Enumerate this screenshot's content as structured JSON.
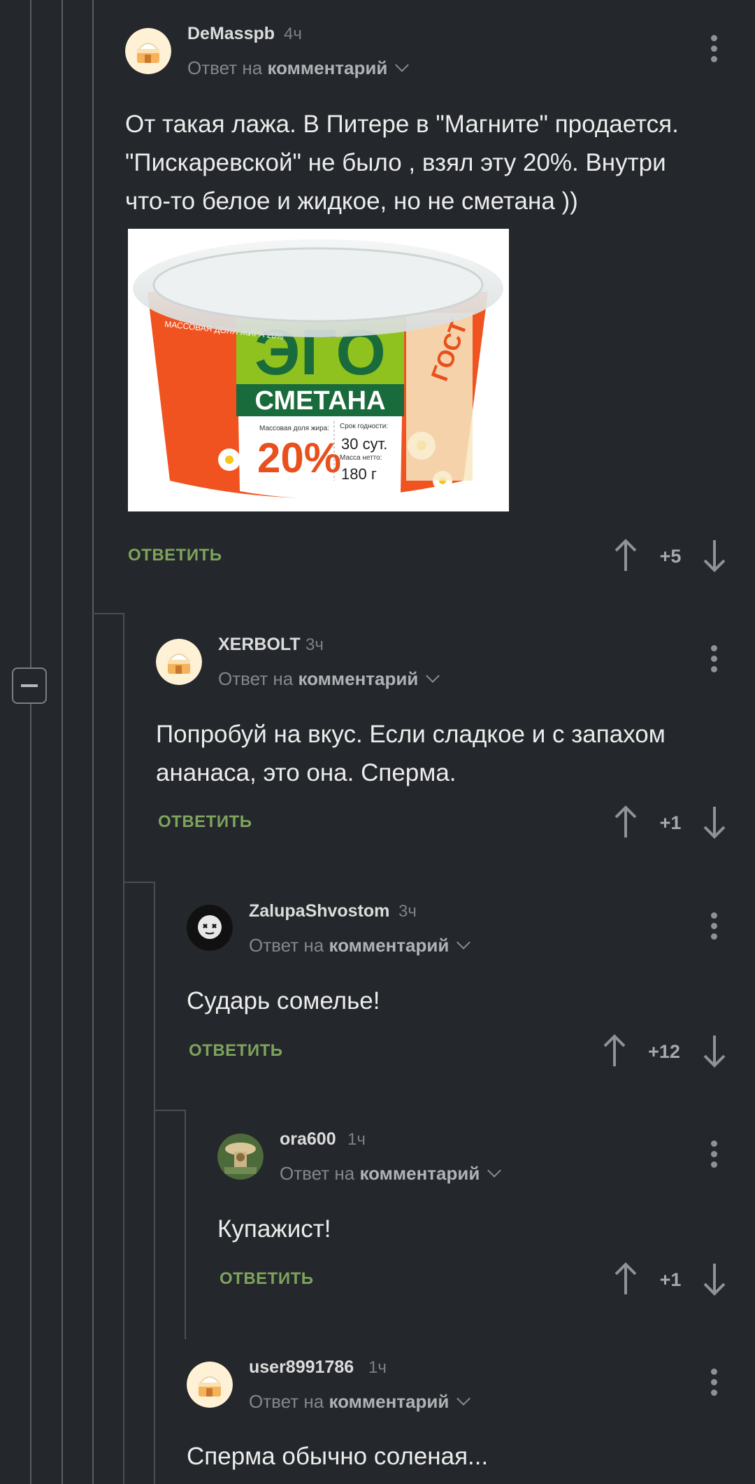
{
  "comments": [
    {
      "user": "DeMasspb",
      "time": "4ч",
      "reply_prefix": "Ответ на",
      "reply_target": "комментарий",
      "text_lines": [
        "От такая лажа. В Питере в \"Магните\" продается.",
        "\"Пискаревской\" не было , взял эту 20%. Внутри",
        "что-то белое и жидкое, но не сметана ))"
      ],
      "answer": "ОТВЕТИТЬ",
      "score": "+5",
      "avatar": "cake-avatar"
    },
    {
      "user": "XERBOLT",
      "time": "3ч",
      "reply_prefix": "Ответ на",
      "reply_target": "комментарий",
      "text_lines": [
        "Попробуй на вкус. Если сладкое и с запахом",
        "ананаса, это она. Сперма."
      ],
      "answer": "ОТВЕТИТЬ",
      "score": "+1",
      "avatar": "cake-avatar"
    },
    {
      "user": "ZalupaShvostom",
      "time": "3ч",
      "reply_prefix": "Ответ на",
      "reply_target": "комментарий",
      "text_lines": [
        "Сударь сомелье!"
      ],
      "answer": "ОТВЕТИТЬ",
      "score": "+12",
      "avatar": "skull-avatar"
    },
    {
      "user": "ora600",
      "time": "1ч",
      "reply_prefix": "Ответ на",
      "reply_target": "комментарий",
      "text_lines": [
        "Купажист!"
      ],
      "answer": "ОТВЕТИТЬ",
      "score": "+1",
      "avatar": "photo-avatar"
    },
    {
      "user": "user8991786",
      "time": "1ч",
      "reply_prefix": "Ответ на",
      "reply_target": "комментарий",
      "text_lines": [
        "Сперма обычно соленая..."
      ],
      "avatar": "cake-avatar"
    }
  ],
  "product_image": {
    "brand": "ЭГО",
    "product": "СМЕТАНА",
    "fat_label": "Массовая доля жира:",
    "fat": "20%",
    "shelf_label": "Срок годности:",
    "shelf": "30 сут.",
    "mass_label": "Масса нетто:",
    "mass": "180 г",
    "side_text": "МАССОВАЯ ДОЛЯ ЖИРА 20%",
    "gost": "ГОСТ"
  },
  "colors": {
    "background": "#24272b",
    "accent_green": "#7ea35d",
    "thread_line": "#4a4d52"
  }
}
